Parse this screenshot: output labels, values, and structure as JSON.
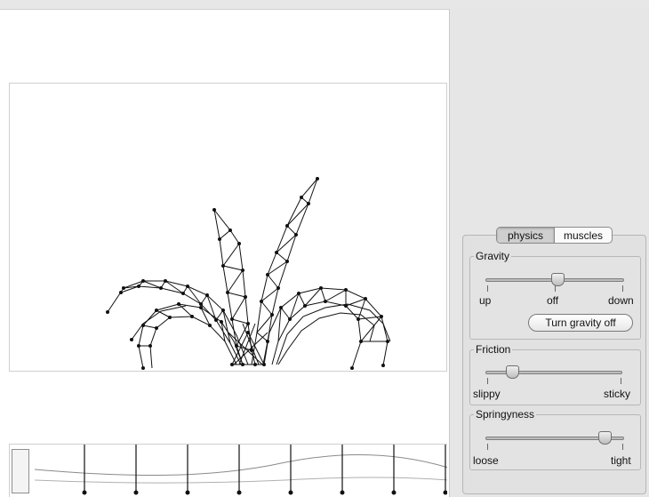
{
  "tabs": {
    "physics": "physics",
    "muscles": "muscles",
    "active": "physics"
  },
  "gravity": {
    "title": "Gravity",
    "labels": {
      "min": "up",
      "mid": "off",
      "max": "down"
    },
    "value_fraction": 0.5,
    "button_label": "Turn gravity off"
  },
  "friction": {
    "title": "Friction",
    "labels": {
      "min": "slippy",
      "max": "sticky"
    },
    "value_fraction": 0.18
  },
  "springyness": {
    "title": "Springyness",
    "labels": {
      "min": "loose",
      "max": "tight"
    },
    "value_fraction": 0.88
  },
  "colors": {
    "panel": "#e6e6e6",
    "canvas": "#ffffff",
    "lines": "#111111"
  }
}
